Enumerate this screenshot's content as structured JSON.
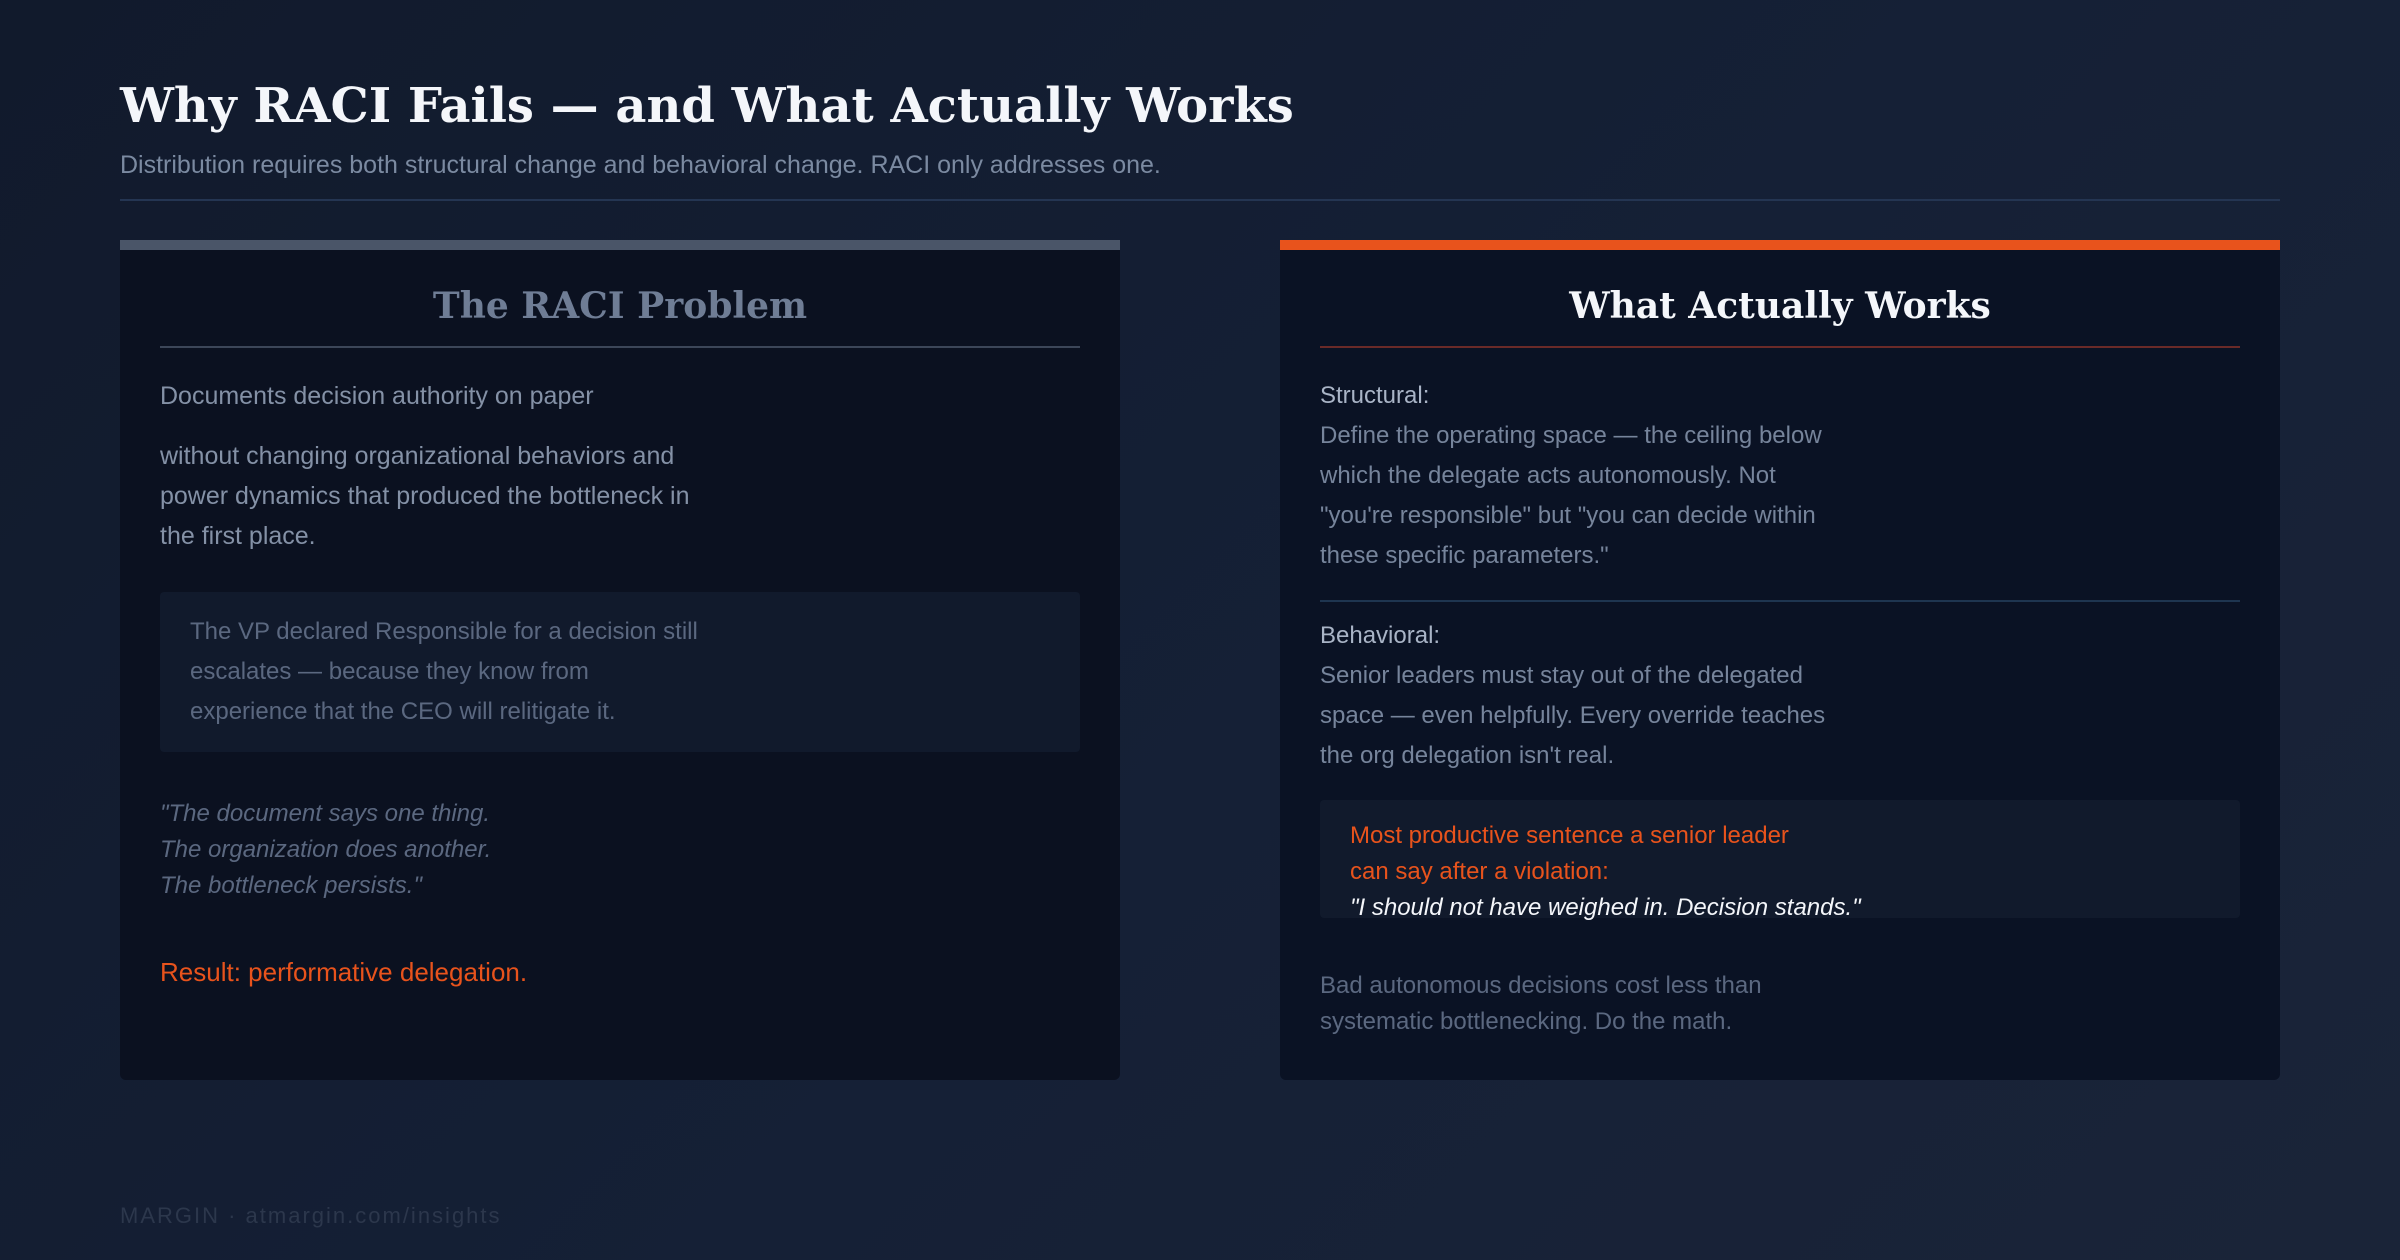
{
  "header": {
    "title": "Why RACI Fails — and What Actually Works",
    "subtitle": "Distribution requires both structural change and behavioral change. RACI only addresses one."
  },
  "left_card": {
    "title": "The RACI Problem",
    "lead_1": "Documents decision authority on paper",
    "lead_2": "without changing organizational behaviors and power dynamics that produced the bottleneck in the first place.",
    "callout": "The VP declared Responsible for a decision still escalates — because they know from experience that the CEO will relitigate it.",
    "quote_lines": [
      "\"The document says one thing.",
      "The organization does another.",
      "The bottleneck persists.\""
    ],
    "result": "Result: performative delegation."
  },
  "right_card": {
    "title": "What Actually Works",
    "structural": {
      "label": "Structural:",
      "body": "Define the operating space — the ceiling below which the delegate acts autonomously. Not \"you're responsible\" but \"you can decide within these specific parameters.\""
    },
    "behavioral": {
      "label": "Behavioral:",
      "body": "Senior leaders must stay out of the delegated space — even helpfully. Every override teaches the org delegation isn't real."
    },
    "highlight": {
      "line_1": "Most productive sentence a senior leader",
      "line_2": "can say after a violation:",
      "quote": "\"I should not have weighed in. Decision stands.\""
    },
    "footnote": "Bad autonomous decisions cost less than systematic bottlenecking. Do the math."
  },
  "footer": {
    "text": "MARGIN · atmargin.com/insights"
  },
  "colors": {
    "accent": "#e8531c",
    "neutral_bar": "#4a5568",
    "background": "#131c2e"
  }
}
